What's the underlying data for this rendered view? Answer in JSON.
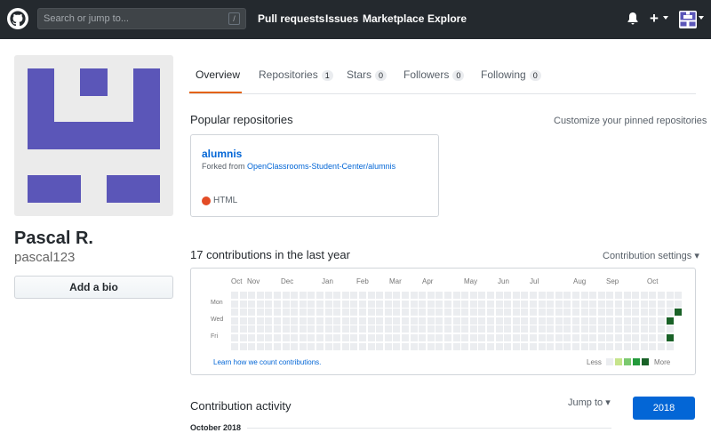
{
  "header": {
    "search_placeholder": "Search or jump to...",
    "search_shortcut": "/",
    "nav": [
      "Pull requests",
      "Issues",
      "Marketplace",
      "Explore"
    ],
    "icons": [
      "github-logo-icon",
      "bell-icon",
      "plus-icon",
      "avatar-icon"
    ]
  },
  "profile": {
    "fullname": "Pascal R.",
    "username": "pascal123",
    "bio_button": "Add a bio",
    "avatar_color": "#5b56b8"
  },
  "tabs": [
    {
      "label": "Overview",
      "count": null
    },
    {
      "label": "Repositories",
      "count": "1"
    },
    {
      "label": "Stars",
      "count": "0"
    },
    {
      "label": "Followers",
      "count": "0"
    },
    {
      "label": "Following",
      "count": "0"
    }
  ],
  "popular": {
    "title": "Popular repositories",
    "customize": "Customize your pinned repositories",
    "repo": {
      "name": "alumnis",
      "forked_prefix": "Forked from ",
      "forked_link": "OpenClassrooms-Student-Center/alumnis",
      "language": "HTML",
      "language_color": "#e34c26"
    }
  },
  "contributions": {
    "title": "17 contributions in the last year",
    "settings": "Contribution settings",
    "months": [
      "Oct",
      "Nov",
      "Dec",
      "Jan",
      "Feb",
      "Mar",
      "Apr",
      "May",
      "Jun",
      "Jul",
      "Aug",
      "Sep",
      "Oct"
    ],
    "days": [
      "Mon",
      "Wed",
      "Fri"
    ],
    "learn": "Learn how we count contributions.",
    "less": "Less",
    "more": "More",
    "weeks": 53,
    "active_cells": [
      {
        "week": 51,
        "day": 3,
        "level": 4
      },
      {
        "week": 51,
        "day": 5,
        "level": 4
      },
      {
        "week": 52,
        "day": 2,
        "level": 4
      }
    ],
    "colors": [
      "#ebedf0",
      "#c6e48b",
      "#7bc96f",
      "#239a3b",
      "#196127"
    ]
  },
  "activity": {
    "title": "Contribution activity",
    "jump": "Jump to",
    "year": "2018",
    "month_label": "October 2018"
  }
}
